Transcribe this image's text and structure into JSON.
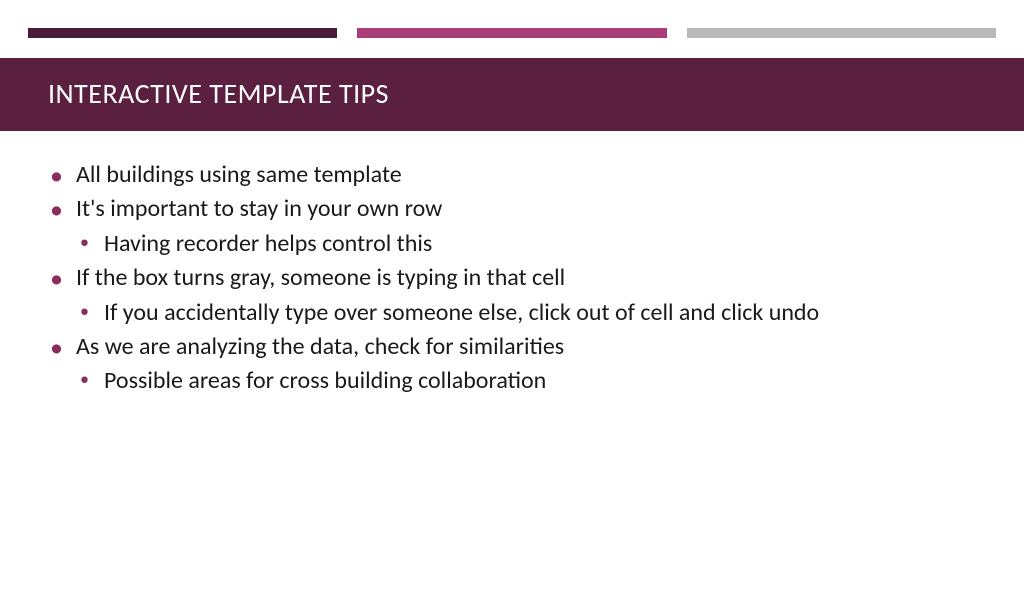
{
  "title": "INTERACTIVE TEMPLATE TIPS",
  "bullets": [
    {
      "text": "All buildings using same template",
      "children": []
    },
    {
      "text": "It's important to stay in your own row",
      "children": [
        "Having recorder helps control this"
      ]
    },
    {
      "text": "If the box turns gray, someone is typing in that cell",
      "children": [
        "If you accidentally type over someone else, click out of cell and click undo"
      ]
    },
    {
      "text": "As we are analyzing the data, check for similarities",
      "children": [
        "Possible areas for cross building collaboration"
      ]
    }
  ],
  "colors": {
    "accent_dark": "#5b1f3f",
    "accent_mid": "#a83d7a",
    "accent_light": "#b8b8b8",
    "bullet": "#8a2c5e"
  }
}
